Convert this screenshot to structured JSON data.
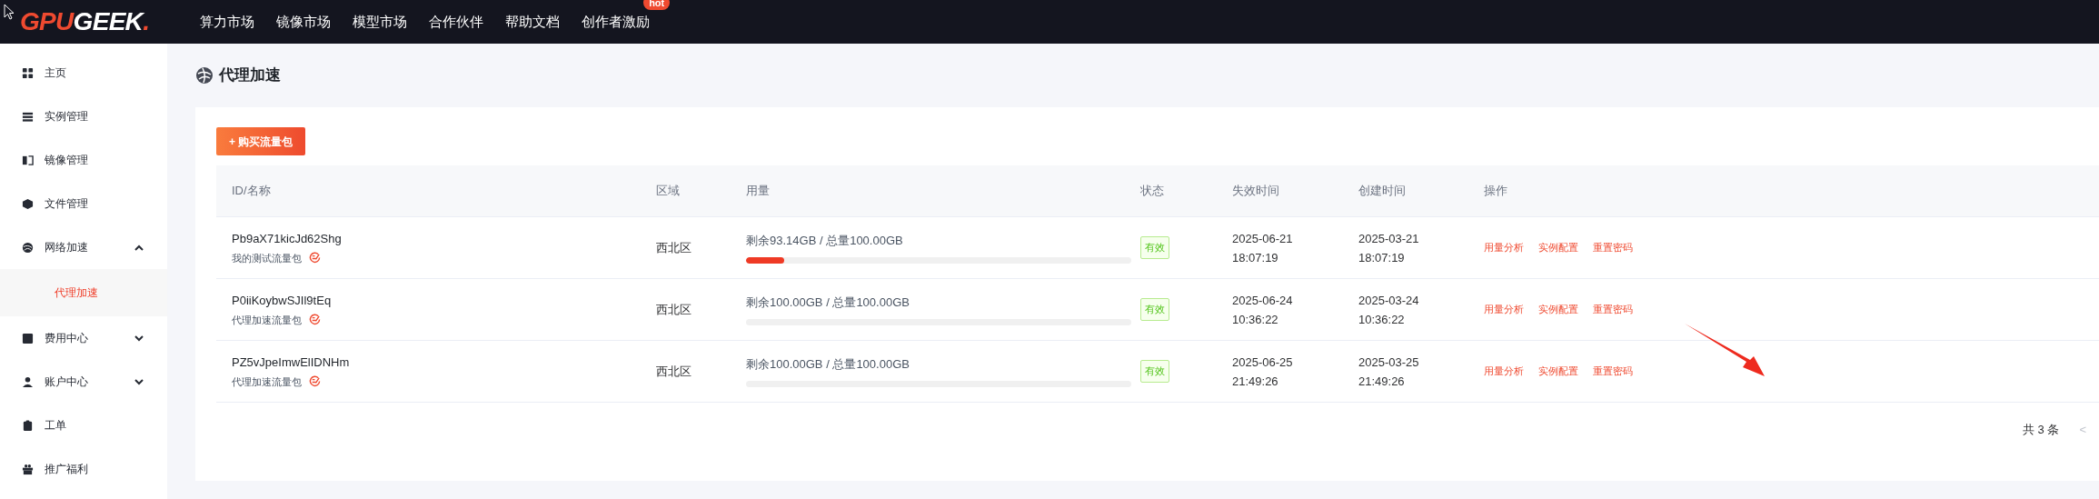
{
  "header": {
    "logo_main": "GPU",
    "logo_accent": "GEEK",
    "logo_dot": ".",
    "nav": [
      {
        "label": "算力市场"
      },
      {
        "label": "镜像市场"
      },
      {
        "label": "模型市场"
      },
      {
        "label": "合作伙伴"
      },
      {
        "label": "帮助文档"
      },
      {
        "label": "创作者激励",
        "badge": "hot"
      }
    ]
  },
  "sidebar": {
    "items": [
      {
        "label": "主页"
      },
      {
        "label": "实例管理"
      },
      {
        "label": "镜像管理"
      },
      {
        "label": "文件管理"
      },
      {
        "label": "网络加速",
        "expanded": true,
        "children": [
          {
            "label": "代理加速",
            "selected": true
          }
        ]
      },
      {
        "label": "费用中心",
        "expanded": false
      },
      {
        "label": "账户中心",
        "expanded": false
      },
      {
        "label": "工单"
      },
      {
        "label": "推广福利"
      }
    ]
  },
  "page": {
    "title": "代理加速",
    "buy_button": "+ 购买流量包"
  },
  "table": {
    "columns": [
      "ID/名称",
      "区域",
      "用量",
      "状态",
      "失效时间",
      "创建时间",
      "操作"
    ],
    "rows": [
      {
        "id": "Pb9aX71kicJd62Shg",
        "name": "我的测试流量包",
        "region": "西北区",
        "usage": "剩余93.14GB / 总量100.00GB",
        "level": 0.1,
        "status": "有效",
        "expires": [
          "2025-06-21",
          "18:07:19"
        ],
        "created": [
          "2025-03-21",
          "18:07:19"
        ],
        "actions": [
          "用量分析",
          "实例配置",
          "重置密码"
        ]
      },
      {
        "id": "P0iiKoybwSJIl9tEq",
        "name": "代理加速流量包",
        "region": "西北区",
        "usage": "剩余100.00GB / 总量100.00GB",
        "level": 0,
        "status": "有效",
        "expires": [
          "2025-06-24",
          "10:36:22"
        ],
        "created": [
          "2025-03-24",
          "10:36:22"
        ],
        "actions": [
          "用量分析",
          "实例配置",
          "重置密码"
        ]
      },
      {
        "id": "PZ5vJpeImwElIDNHm",
        "name": "代理加速流量包",
        "region": "西北区",
        "usage": "剩余100.00GB / 总量100.00GB",
        "level": 0,
        "status": "有效",
        "expires": [
          "2025-06-25",
          "21:49:26"
        ],
        "created": [
          "2025-03-25",
          "21:49:26"
        ],
        "actions": [
          "用量分析",
          "实例配置",
          "重置密码"
        ]
      }
    ]
  },
  "pagination": {
    "total": "共 3 条",
    "prev": "<"
  }
}
